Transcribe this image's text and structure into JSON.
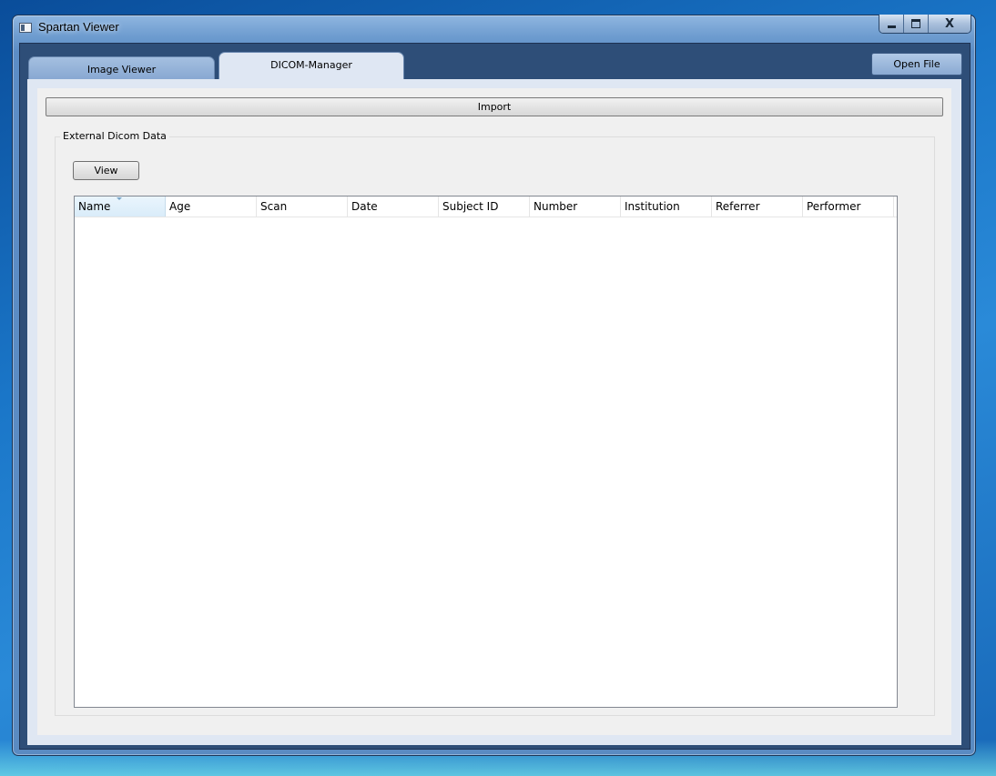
{
  "window": {
    "title": "Spartan Viewer",
    "controls": {
      "minimize": "minimize",
      "maximize": "maximize",
      "close": "X"
    }
  },
  "tabs": [
    {
      "label": "Image Viewer",
      "active": false
    },
    {
      "label": "DICOM-Manager",
      "active": true
    }
  ],
  "toolbar": {
    "open_file_label": "Open File"
  },
  "dicom_manager": {
    "import_label": "Import",
    "group_title": "External Dicom Data",
    "view_label": "View",
    "table": {
      "columns": [
        "Name",
        "Age",
        "Scan",
        "Date",
        "Subject ID",
        "Number",
        "Institution",
        "Referrer",
        "Performer"
      ],
      "sorted_column": "Name",
      "rows": []
    }
  },
  "colors": {
    "title_bar": "#6f9dd0",
    "client_background": "#2e4e78",
    "active_tab": "#dfe7f3",
    "inactive_tab": "#88a8d2",
    "panel": "#f0f0f0"
  }
}
